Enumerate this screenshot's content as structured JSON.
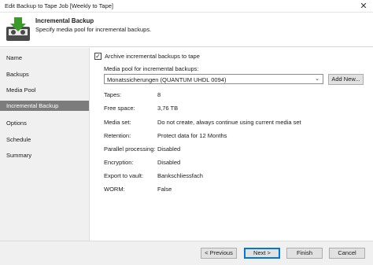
{
  "window": {
    "title": "Edit Backup to Tape Job [Weekly to Tape]",
    "close_glyph": "✕"
  },
  "header": {
    "title": "Incremental Backup",
    "subtitle": "Specify media pool for incremental backups.",
    "logo_icon": "tape-download-icon"
  },
  "sidebar": {
    "items": [
      {
        "label": "Name",
        "active": false
      },
      {
        "label": "Backups",
        "active": false
      },
      {
        "label": "Media Pool",
        "active": false
      },
      {
        "label": "Incremental Backup",
        "active": true
      },
      {
        "label": "Options",
        "active": false
      },
      {
        "label": "Schedule",
        "active": false
      },
      {
        "label": "Summary",
        "active": false
      }
    ]
  },
  "main": {
    "archive_checkbox": {
      "label": "Archive incremental backups to tape",
      "checked": true,
      "check_glyph": "✓"
    },
    "media_pool": {
      "label": "Media pool for incremental backups:",
      "selected": "Monatssicherungen (QUANTUM UHDL 0094)",
      "arrow_glyph": "⌄",
      "add_new_label": "Add New..."
    },
    "details": [
      {
        "label": "Tapes:",
        "value": "8"
      },
      {
        "label": "Free space:",
        "value": "3,76 TB"
      },
      {
        "label": "Media set:",
        "value": "Do not create, always continue using current media set"
      },
      {
        "label": "Retention:",
        "value": "Protect data for 12 Months"
      },
      {
        "label": "Parallel processing:",
        "value": "Disabled"
      },
      {
        "label": "Encryption:",
        "value": "Disabled"
      },
      {
        "label": "Export to vault:",
        "value": "Bankschliessfach"
      },
      {
        "label": "WORM:",
        "value": "False"
      }
    ]
  },
  "footer": {
    "previous_label": "< Previous",
    "next_label": "Next >",
    "finish_label": "Finish",
    "cancel_label": "Cancel"
  },
  "colors": {
    "sidebar_active": "#7c7c7c",
    "sidebar_bg": "#f0f0f0",
    "primary_border": "#0078d7",
    "logo_green": "#3a9a2a",
    "logo_tape": "#4a4a4a"
  }
}
